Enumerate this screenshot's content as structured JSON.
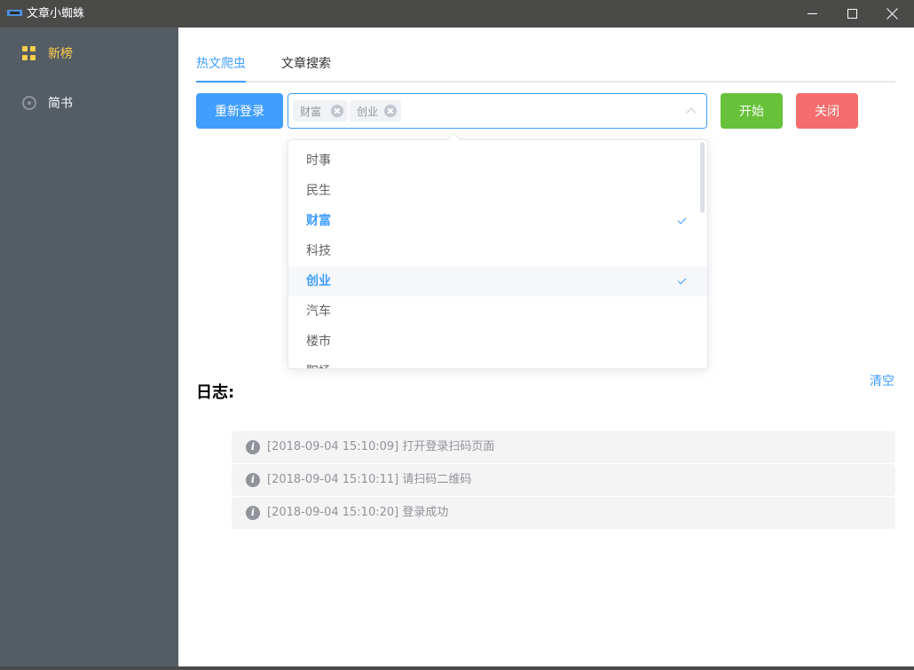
{
  "window": {
    "title": "文章小蜘蛛"
  },
  "sidebar": {
    "items": [
      {
        "label": "新榜",
        "icon": "grid-icon"
      },
      {
        "label": "简书",
        "icon": "gear-icon"
      }
    ]
  },
  "tabs": [
    {
      "label": "热文爬虫"
    },
    {
      "label": "文章搜索"
    }
  ],
  "buttons": {
    "relogin": "重新登录",
    "start": "开始",
    "close": "关闭"
  },
  "select": {
    "tags": [
      {
        "label": "财富"
      },
      {
        "label": "创业"
      }
    ]
  },
  "dropdown": {
    "options": [
      {
        "label": "时事",
        "selected": false
      },
      {
        "label": "民生",
        "selected": false
      },
      {
        "label": "财富",
        "selected": true
      },
      {
        "label": "科技",
        "selected": false
      },
      {
        "label": "创业",
        "selected": true
      },
      {
        "label": "汽车",
        "selected": false
      },
      {
        "label": "楼市",
        "selected": false
      },
      {
        "label": "职场",
        "selected": false
      }
    ]
  },
  "log": {
    "title": "日志:",
    "clear_label": "清空",
    "entries": [
      {
        "text": "[2018-09-04 15:10:09] 打开登录扫码页面"
      },
      {
        "text": "[2018-09-04 15:10:11] 请扫码二维码"
      },
      {
        "text": "[2018-09-04 15:10:20] 登录成功"
      }
    ]
  },
  "colors": {
    "primary": "#409eff",
    "success": "#67c23a",
    "danger": "#f56c6c",
    "sidebar": "#545c64",
    "sidebar_active": "#ffd04b"
  }
}
